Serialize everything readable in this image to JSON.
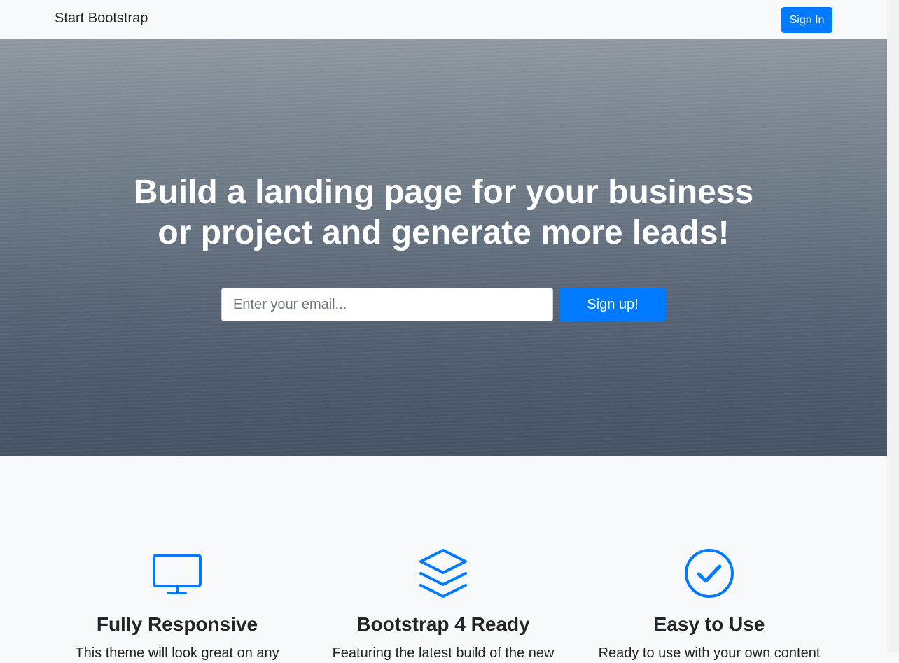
{
  "navbar": {
    "brand": "Start Bootstrap",
    "signin_label": "Sign In"
  },
  "masthead": {
    "headline_line1": "Build a landing page for your business",
    "headline_line2": "or project and generate more leads!",
    "email_placeholder": "Enter your email...",
    "signup_label": "Sign up!"
  },
  "features": [
    {
      "icon": "desktop-icon",
      "title": "Fully Responsive",
      "description": "This theme will look great on any"
    },
    {
      "icon": "layers-icon",
      "title": "Bootstrap 4 Ready",
      "description": "Featuring the latest build of the new"
    },
    {
      "icon": "check-circle-icon",
      "title": "Easy to Use",
      "description": "Ready to use with your own content"
    }
  ],
  "colors": {
    "primary": "#007bff",
    "background": "#f8f9fa",
    "text": "#212529"
  }
}
